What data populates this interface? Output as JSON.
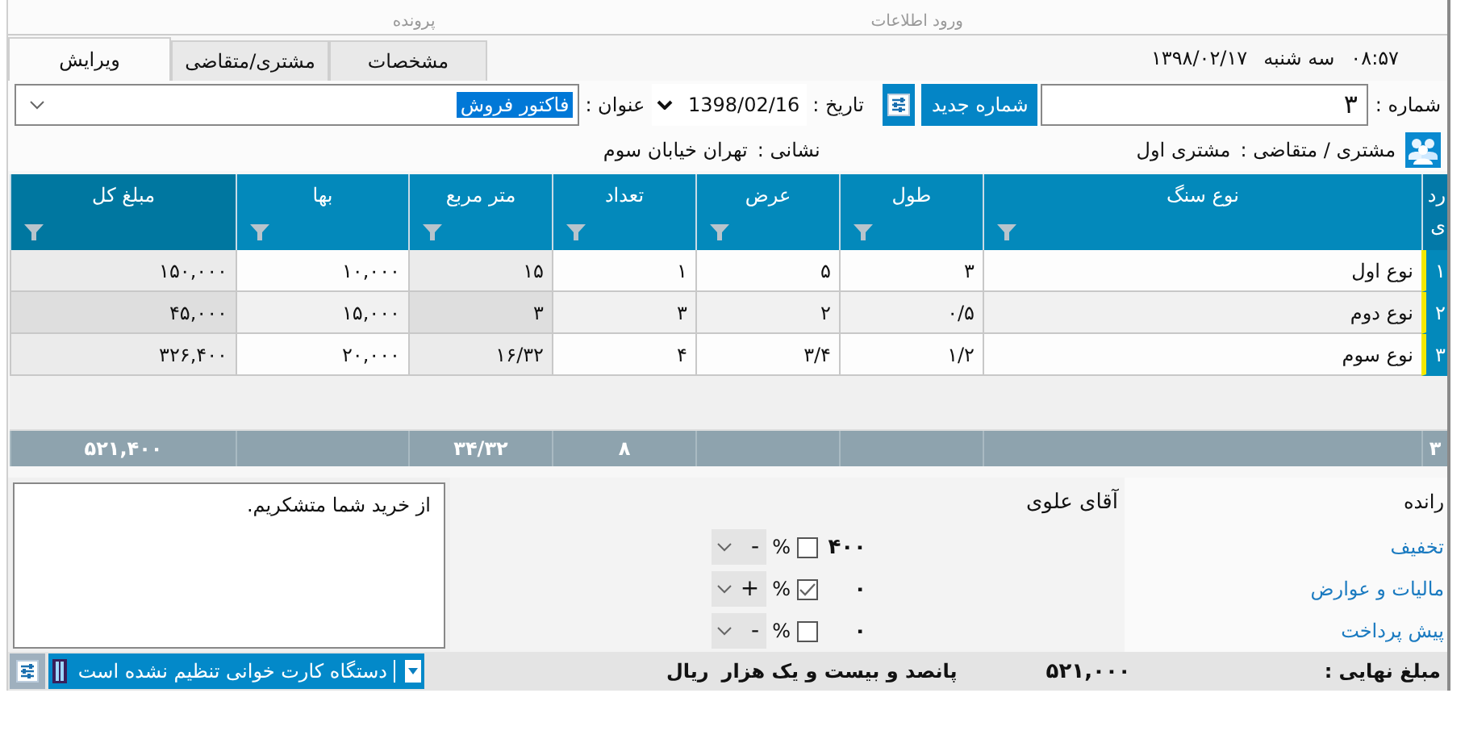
{
  "menu": [
    {
      "label": "ورود اطلاعات"
    },
    {
      "label": "پرونده"
    }
  ],
  "clock": {
    "time": "۰۸:۵۷",
    "weekday": "سه شنبه",
    "date": "۱۳۹۸/۰۲/۱۷"
  },
  "tabs": [
    {
      "label": "مشخصات",
      "selected": false
    },
    {
      "label": "مشتری/متقاضی",
      "selected": false
    },
    {
      "label": "ویرایش",
      "selected": true
    }
  ],
  "form": {
    "number_label": "شماره :",
    "number": "۳",
    "new_number_button": "شماره جدید",
    "date_label": "تاریخ :",
    "date": "1398/02/16",
    "title_label": "عنوان :",
    "title": "فاکتور فروش"
  },
  "customer": {
    "label": "مشتری / متقاضی :",
    "name": "مشتری اول",
    "address_label": "نشانی :",
    "address": "تهران خیابان سوم"
  },
  "table": {
    "columns": [
      {
        "label": "ردی",
        "filter": false,
        "readonly": false
      },
      {
        "label": "نوع سنگ",
        "filter": true,
        "readonly": false
      },
      {
        "label": "طول",
        "filter": true,
        "readonly": false
      },
      {
        "label": "عرض",
        "filter": true,
        "readonly": false
      },
      {
        "label": "تعداد",
        "filter": true,
        "readonly": false
      },
      {
        "label": "متر مربع",
        "filter": true,
        "readonly": true
      },
      {
        "label": "بها",
        "filter": true,
        "readonly": false
      },
      {
        "label": "مبلغ کل",
        "filter": true,
        "readonly": true
      }
    ],
    "rows": [
      {
        "cells": [
          "۱",
          "نوع اول",
          "۳",
          "۵",
          "۱",
          "۱۵",
          "۱۰,۰۰۰",
          "۱۵۰,۰۰۰"
        ]
      },
      {
        "cells": [
          "۲",
          "نوع دوم",
          "۰/۵",
          "۲",
          "۳",
          "۳",
          "۱۵,۰۰۰",
          "۴۵,۰۰۰"
        ]
      },
      {
        "cells": [
          "۳",
          "نوع سوم",
          "۱/۲",
          "۳/۴",
          "۴",
          "۱۶/۳۲",
          "۲۰,۰۰۰",
          "۳۲۶,۴۰۰"
        ]
      }
    ],
    "totals": {
      "row_count": "۳",
      "quantity": "۸",
      "square_meters": "۳۴/۳۲",
      "amount": "۵۲۱,۴۰۰"
    }
  },
  "summary": {
    "driver_label": "رانده",
    "driver": "آقای علوی",
    "adjustments": [
      {
        "label": "تخفیف",
        "value": "۴۰۰",
        "checked": false,
        "unit": "%",
        "sign": "-"
      },
      {
        "label": "مالیات و عوارض",
        "value": "۰",
        "checked": true,
        "unit": "%",
        "sign": "+"
      },
      {
        "label": "پیش پرداخت",
        "value": "۰",
        "checked": false,
        "unit": "%",
        "sign": "-"
      }
    ]
  },
  "notes": "از خرید شما متشکریم.",
  "status_bar": {
    "total_label": "مبلغ نهایی :",
    "total": "۵۲۱,۰۰۰",
    "amount_words": "پانصد و بیست و یک هزار",
    "currency": "ریال",
    "card_reader": "دستگاه کارت خوانی تنظیم نشده است"
  }
}
